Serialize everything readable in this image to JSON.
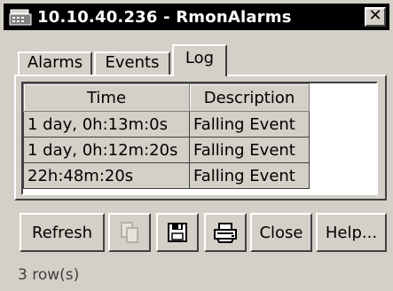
{
  "window": {
    "title": "10.10.40.236 - RmonAlarms",
    "close_glyph": "✕"
  },
  "tabs": [
    {
      "label": "Alarms"
    },
    {
      "label": "Events"
    },
    {
      "label": "Log",
      "active": true
    }
  ],
  "table": {
    "columns": [
      "Time",
      "Description"
    ],
    "rows": [
      [
        "1 day, 0h:13m:0s",
        "Falling Event"
      ],
      [
        "1 day, 0h:12m:20s",
        "Falling Event"
      ],
      [
        "22h:48m:20s",
        "Falling Event"
      ]
    ]
  },
  "buttons": {
    "refresh": "Refresh",
    "copy_icon": "copy-icon",
    "save_icon": "save-icon",
    "print_icon": "print-icon",
    "close": "Close",
    "help": "Help..."
  },
  "status": "3 row(s)"
}
